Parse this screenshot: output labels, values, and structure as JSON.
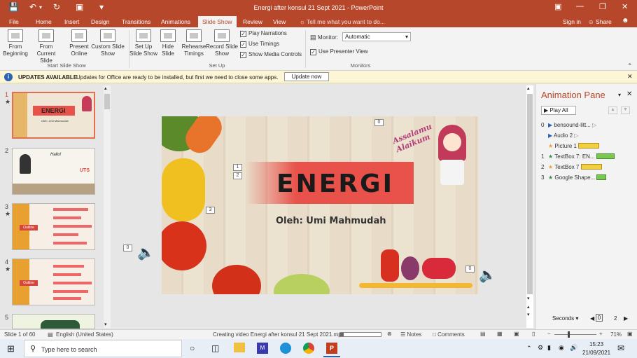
{
  "window": {
    "title": "Energi after konsul 21 Sept 2021  -  PowerPoint"
  },
  "menu": {
    "tabs": [
      "File",
      "Home",
      "Insert",
      "Design",
      "Transitions",
      "Animations",
      "Slide Show",
      "Review",
      "View"
    ],
    "active": "Slide Show",
    "tell_me": "Tell me what you want to do...",
    "sign_in": "Sign in",
    "share": "Share"
  },
  "ribbon": {
    "start_group": {
      "label": "Start Slide Show",
      "from_beginning": "From Beginning",
      "from_current": "From Current Slide",
      "present_online": "Present Online",
      "custom_show": "Custom Slide Show"
    },
    "setup_group": {
      "label": "Set Up",
      "setup_show": "Set Up Slide Show",
      "hide_slide": "Hide Slide",
      "rehearse": "Rehearse Timings",
      "record": "Record Slide Show",
      "play_narrations": "Play Narrations",
      "use_timings": "Use Timings",
      "show_media_controls": "Show Media Controls"
    },
    "monitors_group": {
      "label": "Monitors",
      "monitor_label": "Monitor:",
      "monitor_value": "Automatic",
      "use_presenter_view": "Use Presenter View"
    }
  },
  "update_bar": {
    "title": "UPDATES AVAILABLE",
    "message": "Updates for Office are ready to be installed, but first we need to close some apps.",
    "button": "Update now"
  },
  "thumbnails": [
    {
      "num": "1",
      "title": "ENERGI",
      "subtitle": "Oleh: Umi Mahmudah"
    },
    {
      "num": "2",
      "title": "Hallo!",
      "badge": "UTS"
    },
    {
      "num": "3",
      "title": "Outline"
    },
    {
      "num": "4",
      "title": "Outline"
    },
    {
      "num": "5",
      "title": ""
    }
  ],
  "slide": {
    "title": "ENERGI",
    "subtitle": "Oleh: Umi Mahmudah",
    "greeting": "Assalamu Alaikum",
    "tags": [
      "0",
      "1",
      "2",
      "3",
      "0",
      "0"
    ]
  },
  "anim_pane": {
    "title": "Animation Pane",
    "play_all": "Play All",
    "items": [
      {
        "num": "0",
        "name": "bensound-litt..."
      },
      {
        "num": "",
        "name": "Audio 2"
      },
      {
        "num": "",
        "name": "Picture 1"
      },
      {
        "num": "1",
        "name": "TextBox 7: EN..."
      },
      {
        "num": "2",
        "name": "TextBox 7"
      },
      {
        "num": "3",
        "name": "Google Shape..."
      }
    ],
    "seconds_label": "Seconds",
    "timeline_start": "0",
    "timeline_end": "2"
  },
  "status": {
    "slide_info": "Slide 1 of 60",
    "language": "English (United States)",
    "progress_text": "Creating video Energi after konsul 21 Sept 2021.mp4",
    "progress": 0.08,
    "notes": "Notes",
    "comments": "Comments",
    "zoom": "71%"
  },
  "taskbar": {
    "search_placeholder": "Type here to search",
    "time": "15:23",
    "date": "21/09/2021"
  }
}
